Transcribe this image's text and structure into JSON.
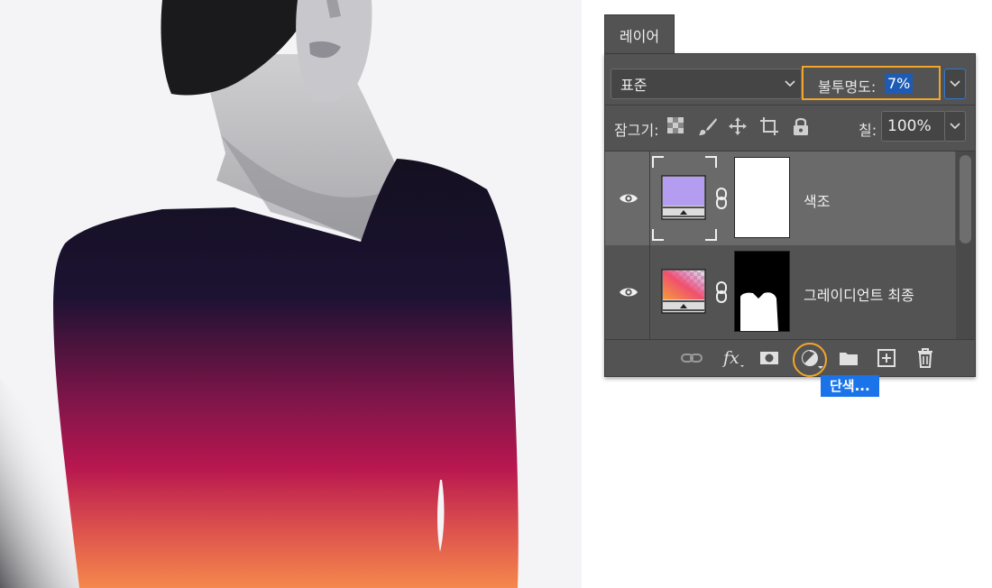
{
  "panel": {
    "tab_label": "레이어",
    "blend_mode": "표준",
    "opacity_label": "불투명도:",
    "opacity_value": "7%",
    "lock_label": "잠그기:",
    "fill_label": "칠:",
    "fill_value": "100%"
  },
  "layers": [
    {
      "name": "색조",
      "selected": true,
      "visible": true,
      "thumb_color": "#b49cf0"
    },
    {
      "name": "그레이디언트 최종",
      "selected": false,
      "visible": true
    }
  ],
  "tooltip": "단색...",
  "colors": {
    "panel_bg": "#535353",
    "highlight": "#f4a528",
    "selection": "#1e5bb4",
    "tooltip_bg": "#1a73e8"
  }
}
